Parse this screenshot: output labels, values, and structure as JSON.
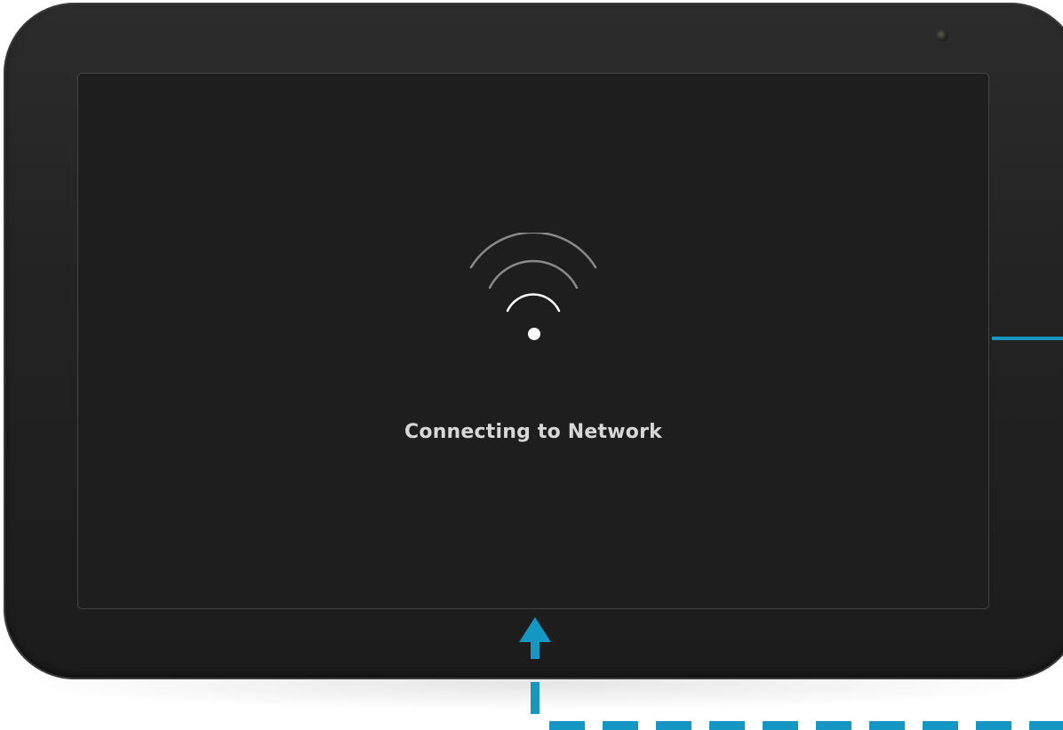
{
  "screen": {
    "status_text": "Connecting to Network",
    "icon": "wifi-icon"
  },
  "colors": {
    "bezel": "#232323",
    "screen_background": "#1e1e1e",
    "status_text": "#d8d8d8",
    "wifi_outer_arc": "#8a8a8a",
    "wifi_inner_arc": "#ffffff",
    "callout_accent": "#1597c4"
  },
  "annotations": {
    "callout_icon": "up-arrow-icon"
  }
}
